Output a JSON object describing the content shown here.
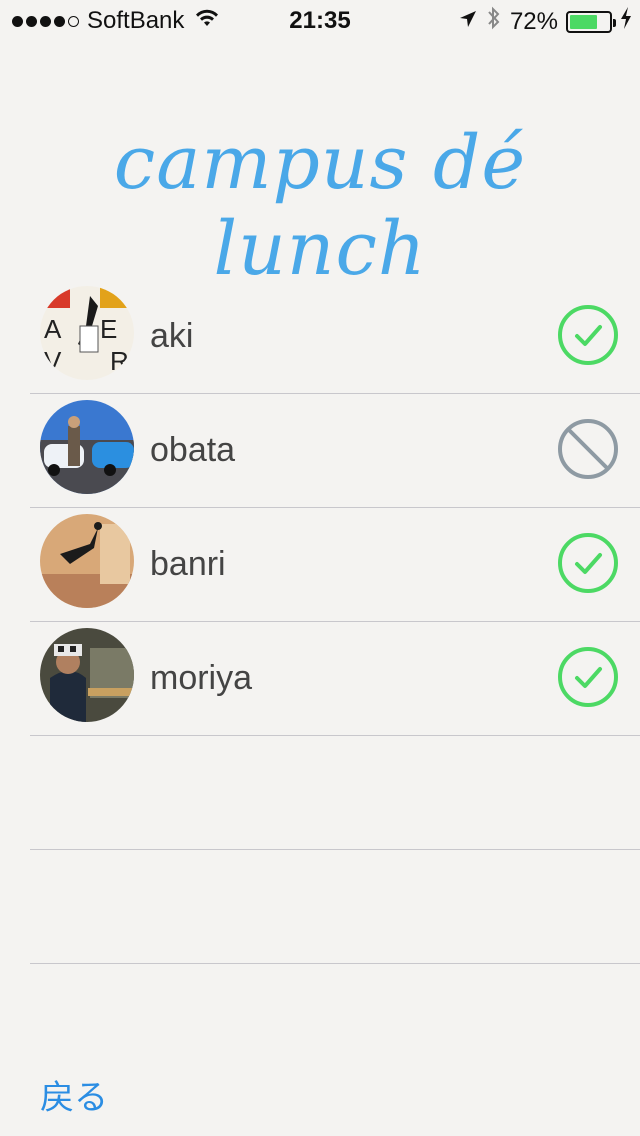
{
  "status_bar": {
    "carrier": "SoftBank",
    "time": "21:35",
    "battery_text": "72%",
    "battery_level": 0.72,
    "signal_filled": 4,
    "signal_total": 5
  },
  "title": "campus dé lunch",
  "members": [
    {
      "name": "aki",
      "status": "attending",
      "status_icon": "check-circle-icon",
      "avatar_desc": "breakdance-photo"
    },
    {
      "name": "obata",
      "status": "not-attending",
      "status_icon": "prohibited-icon",
      "avatar_desc": "car-photo"
    },
    {
      "name": "banri",
      "status": "attending",
      "status_icon": "check-circle-icon",
      "avatar_desc": "dance-studio-photo"
    },
    {
      "name": "moriya",
      "status": "attending",
      "status_icon": "check-circle-icon",
      "avatar_desc": "cafe-photo"
    }
  ],
  "colors": {
    "accent": "#4aa8e8",
    "attending": "#4cd964",
    "not_attending": "#8e9aa3",
    "link": "#2b8de3"
  },
  "back_button": "戻る"
}
